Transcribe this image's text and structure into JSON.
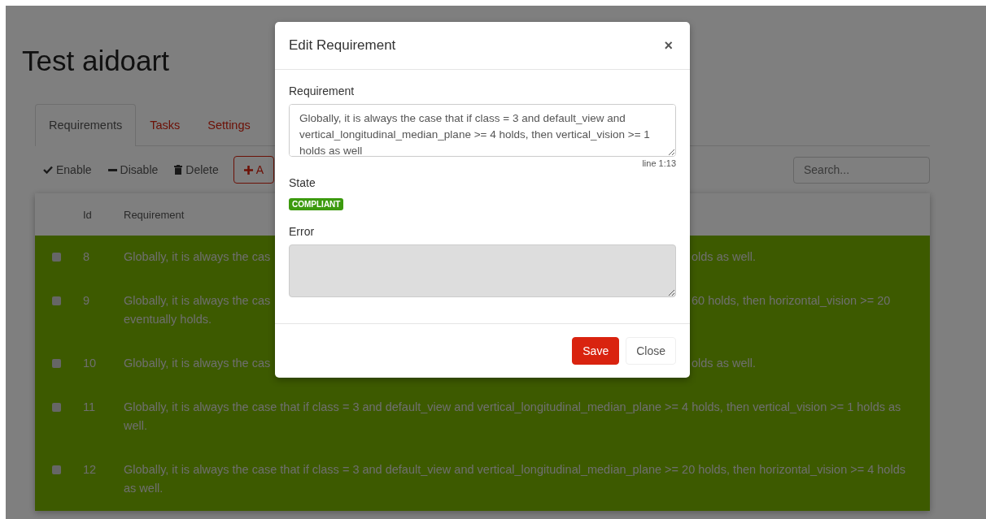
{
  "page": {
    "title": "Test aidoart"
  },
  "tabs": [
    {
      "label": "Requirements",
      "selected": true
    },
    {
      "label": "Tasks",
      "selected": false
    },
    {
      "label": "Settings",
      "selected": false
    }
  ],
  "toolbar": [
    {
      "kind": "enable",
      "label": "Enable"
    },
    {
      "kind": "disable",
      "label": "Disable"
    },
    {
      "kind": "delete",
      "label": "Delete"
    },
    {
      "kind": "add",
      "label": "A"
    }
  ],
  "search": {
    "placeholder": "Search..."
  },
  "table": {
    "columns": [
      "Id",
      "Requirement"
    ],
    "rows": [
      {
        "id": "8",
        "checked": false,
        "visible_left": [
          "Globally, it is always the cas"
        ],
        "visible_right": [
          "olds as well."
        ]
      },
      {
        "id": "9",
        "checked": false,
        "visible_left": [
          "Globally, it is always the cas",
          "eventually holds."
        ],
        "visible_right": [
          "60 holds, then horizontal_vision >= 20"
        ]
      },
      {
        "id": "10",
        "checked": false,
        "visible_left": [
          "Globally, it is always the cas"
        ],
        "visible_right": [
          "olds as well."
        ]
      },
      {
        "id": "11",
        "checked": false,
        "requirement": "Globally, it is always the case that if class = 3 and default_view and vertical_longitudinal_median_plane >= 4 holds, then vertical_vision >= 1 holds as well."
      },
      {
        "id": "12",
        "checked": false,
        "requirement": "Globally, it is always the case that if class = 3 and default_view and vertical_longitudinal_median_plane >= 20 holds, then horizontal_vision >= 4 holds as well."
      }
    ]
  },
  "modal": {
    "title": "Edit Requirement",
    "close": "×",
    "requirement_label": "Requirement",
    "requirement_value": "Globally, it is always the case that if class = 3 and default_view and vertical_longitudinal_median_plane >= 4 holds, then vertical_vision >= 1 holds as well",
    "cursor": "line 1:13",
    "state_label": "State",
    "state": "COMPLIANT",
    "error_label": "Error",
    "buttons": [
      {
        "kind": "primary",
        "label": "Save"
      },
      {
        "kind": "default",
        "label": "Close"
      }
    ]
  }
}
